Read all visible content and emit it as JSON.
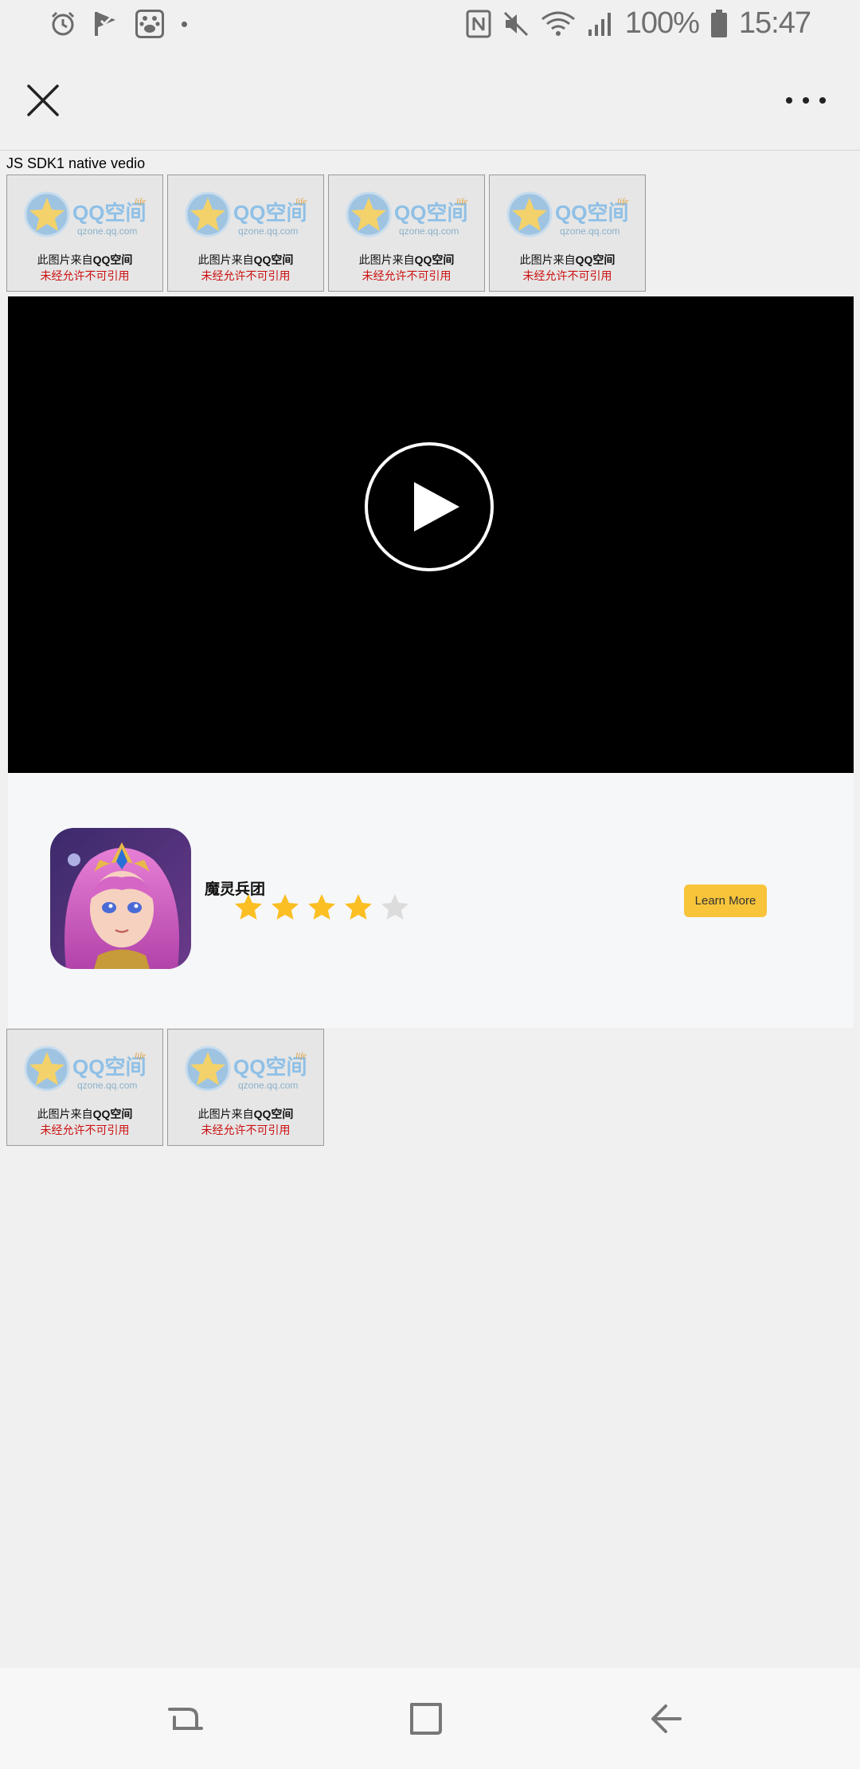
{
  "status_bar": {
    "battery": "100%",
    "time": "15:47",
    "icons": [
      "alarm-icon",
      "check-flag-icon",
      "paw-icon",
      "nfc-icon",
      "mute-icon",
      "wifi-icon",
      "signal-icon",
      "battery-icon"
    ]
  },
  "app_bar": {
    "icons": [
      "close-icon",
      "more-icon"
    ]
  },
  "page": {
    "label": "JS SDK1 native vedio"
  },
  "thumbnails_top": [
    {
      "logo": "QQ空间",
      "domain": "qzone.qq.com",
      "life": "life",
      "line1_a": "此图片来自",
      "line1_b": "QQ空间",
      "line2": "未经允许不可引用"
    },
    {
      "logo": "QQ空间",
      "domain": "qzone.qq.com",
      "life": "life",
      "line1_a": "此图片来自",
      "line1_b": "QQ空间",
      "line2": "未经允许不可引用"
    },
    {
      "logo": "QQ空间",
      "domain": "qzone.qq.com",
      "life": "life",
      "line1_a": "此图片来自",
      "line1_b": "QQ空间",
      "line2": "未经允许不可引用"
    },
    {
      "logo": "QQ空间",
      "domain": "qzone.qq.com",
      "life": "life",
      "line1_a": "此图片来自",
      "line1_b": "QQ空间",
      "line2": "未经允许不可引用"
    }
  ],
  "video": {
    "icon": "play-icon"
  },
  "ad": {
    "app_name": "魔灵兵团",
    "rating": 4,
    "rating_max": 5,
    "button": "Learn More",
    "button_color": "#f7c43a",
    "star_color": "#fbbf24",
    "star_empty_color": "#dcdcdc"
  },
  "thumbnails_bottom": [
    {
      "logo": "QQ空间",
      "domain": "qzone.qq.com",
      "life": "life",
      "line1_a": "此图片来自",
      "line1_b": "QQ空间",
      "line2": "未经允许不可引用"
    },
    {
      "logo": "QQ空间",
      "domain": "qzone.qq.com",
      "life": "life",
      "line1_a": "此图片来自",
      "line1_b": "QQ空间",
      "line2": "未经允许不可引用"
    }
  ],
  "nav_bar": {
    "icons": [
      "recents-icon",
      "home-icon",
      "back-icon"
    ]
  }
}
